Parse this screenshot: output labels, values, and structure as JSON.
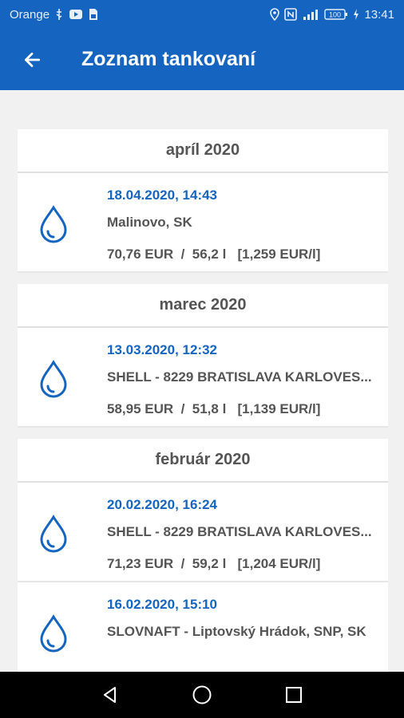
{
  "status_bar": {
    "carrier": "Orange",
    "battery": "100",
    "time": "13:41",
    "icons": [
      "usb-icon",
      "youtube-icon",
      "sim-icon",
      "location-icon",
      "nfc-icon",
      "signal-icon",
      "battery-icon"
    ]
  },
  "app_bar": {
    "title": "Zoznam tankovaní",
    "back_icon": "arrow-back-icon"
  },
  "months": [
    {
      "label": "apríl 2020",
      "entries": [
        {
          "date": "18.04.2020, 14:43",
          "station": "Malinovo, SK",
          "price": "70,76 EUR  /  56,2 l   [1,259 EUR/l]"
        }
      ]
    },
    {
      "label": "marec 2020",
      "entries": [
        {
          "date": "13.03.2020, 12:32",
          "station": "SHELL - 8229 BRATISLAVA KARLOVES...",
          "price": "58,95 EUR  /  51,8 l   [1,139 EUR/l]"
        }
      ]
    },
    {
      "label": "február 2020",
      "entries": [
        {
          "date": "20.02.2020, 16:24",
          "station": "SHELL - 8229 BRATISLAVA KARLOVES...",
          "price": "71,23 EUR  /  59,2 l   [1,204 EUR/l]"
        },
        {
          "date": "16.02.2020, 15:10",
          "station": "SLOVNAFT - Liptovský Hrádok, SNP, SK",
          "price": ""
        }
      ]
    }
  ],
  "colors": {
    "primary": "#1565c0",
    "background": "#f1f1f1",
    "card": "#ffffff",
    "text_secondary": "#555555"
  },
  "nav_bar": {
    "icons": [
      "nav-back-icon",
      "nav-home-icon",
      "nav-recents-icon"
    ]
  }
}
